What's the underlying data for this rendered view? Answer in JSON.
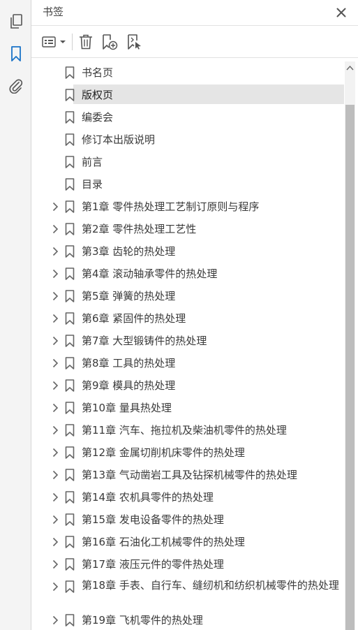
{
  "panel": {
    "title": "书签"
  },
  "rail": {
    "items": [
      "pages-icon",
      "bookmark-icon",
      "attachment-icon"
    ]
  },
  "toolbar": {
    "buttons": [
      "options-menu-icon",
      "delete-icon",
      "new-bookmark-icon",
      "bookmark-from-structure-icon"
    ]
  },
  "colors": {
    "accent": "#1a73c8",
    "selected_row": "#e5e5e5",
    "scroll_thumb": "#bdbdbd"
  },
  "bookmarks": [
    {
      "label": "书名页",
      "expandable": false,
      "selected": false
    },
    {
      "label": "版权页",
      "expandable": false,
      "selected": true
    },
    {
      "label": "编委会",
      "expandable": false,
      "selected": false
    },
    {
      "label": "修订本出版说明",
      "expandable": false,
      "selected": false
    },
    {
      "label": "前言",
      "expandable": false,
      "selected": false
    },
    {
      "label": "目录",
      "expandable": false,
      "selected": false
    },
    {
      "label": "第1章  零件热处理工艺制订原则与程序",
      "expandable": true,
      "selected": false
    },
    {
      "label": "第2章  零件热处理工艺性",
      "expandable": true,
      "selected": false
    },
    {
      "label": "第3章  齿轮的热处理",
      "expandable": true,
      "selected": false
    },
    {
      "label": "第4章  滚动轴承零件的热处理",
      "expandable": true,
      "selected": false
    },
    {
      "label": "第5章  弹簧的热处理",
      "expandable": true,
      "selected": false
    },
    {
      "label": "第6章  紧固件的热处理",
      "expandable": true,
      "selected": false
    },
    {
      "label": "第7章  大型锻铸件的热处理",
      "expandable": true,
      "selected": false
    },
    {
      "label": "第8章  工具的热处理",
      "expandable": true,
      "selected": false
    },
    {
      "label": "第9章  模具的热处理",
      "expandable": true,
      "selected": false
    },
    {
      "label": "第10章  量具热处理",
      "expandable": true,
      "selected": false
    },
    {
      "label": "第11章  汽车、拖拉机及柴油机零件的热处理",
      "expandable": true,
      "selected": false
    },
    {
      "label": "第12章  金属切削机床零件的热处理",
      "expandable": true,
      "selected": false
    },
    {
      "label": "第13章  气动凿岩工具及钻探机械零件的热处理",
      "expandable": true,
      "selected": false
    },
    {
      "label": "第14章  农机具零件的热处理",
      "expandable": true,
      "selected": false
    },
    {
      "label": "第15章  发电设备零件的热处理",
      "expandable": true,
      "selected": false
    },
    {
      "label": "第16章  石油化工机械零件的热处理",
      "expandable": true,
      "selected": false
    },
    {
      "label": "第17章  液压元件的零件热处理",
      "expandable": true,
      "selected": false
    },
    {
      "label": "第18章  手表、自行车、缝纫机和纺织机械零件的热处理",
      "expandable": true,
      "selected": false,
      "wrap": true
    },
    {
      "label": "第19章  飞机零件的热处理",
      "expandable": true,
      "selected": false
    }
  ]
}
